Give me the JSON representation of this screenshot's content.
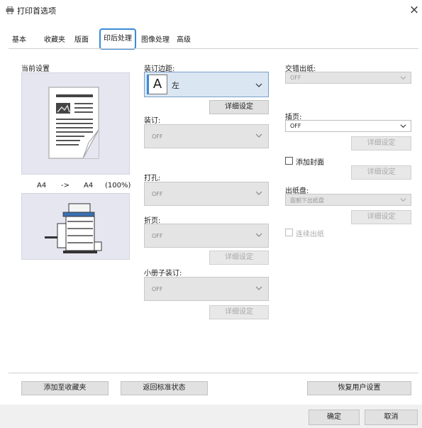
{
  "window": {
    "title": "打印首选项",
    "close_glyph": "×"
  },
  "tabs": [
    {
      "label": "基本"
    },
    {
      "label": "收藏夹"
    },
    {
      "label": "版面"
    },
    {
      "label": "印后处理"
    },
    {
      "label": "图像处理"
    },
    {
      "label": "高级"
    }
  ],
  "left": {
    "current_settings_label": "当前设置",
    "paper_from": "A4",
    "arrow": "->",
    "paper_to": "A4",
    "zoom": "(100%)"
  },
  "middle": {
    "binding_margin": {
      "label": "装订边距:",
      "value": "左",
      "icon_letter": "A",
      "detail_button": "详细设定"
    },
    "staple": {
      "label": "装订:",
      "value": "OFF"
    },
    "punch": {
      "label": "打孔:",
      "value": "OFF"
    },
    "fold": {
      "label": "折页:",
      "value": "OFF",
      "detail_button": "详细设定"
    },
    "booklet": {
      "label": "小册子装订:",
      "value": "OFF",
      "detail_button": "详细设定"
    }
  },
  "right": {
    "offset_output": {
      "label": "交错出纸:",
      "value": "OFF"
    },
    "insert_page": {
      "label": "插页:",
      "value": "OFF",
      "detail_button": "详细设定"
    },
    "add_cover": {
      "label": "添加封面",
      "detail_button": "详细设定"
    },
    "output_tray": {
      "label": "出纸盘:",
      "value": "面朝下出纸盘",
      "detail_button": "详细设定"
    },
    "continuous_output": {
      "label": "连续出纸"
    }
  },
  "footer": {
    "add_to_favorites": "添加至收藏夹",
    "restore_default": "返回标准状态",
    "restore_user": "恢复用户设置"
  },
  "bottom": {
    "ok": "确定",
    "cancel": "取消"
  },
  "colors": {
    "accent": "#3b8bd6",
    "disabled_fill": "#e4e4e4",
    "preview_bg": "#e6e6f0"
  }
}
